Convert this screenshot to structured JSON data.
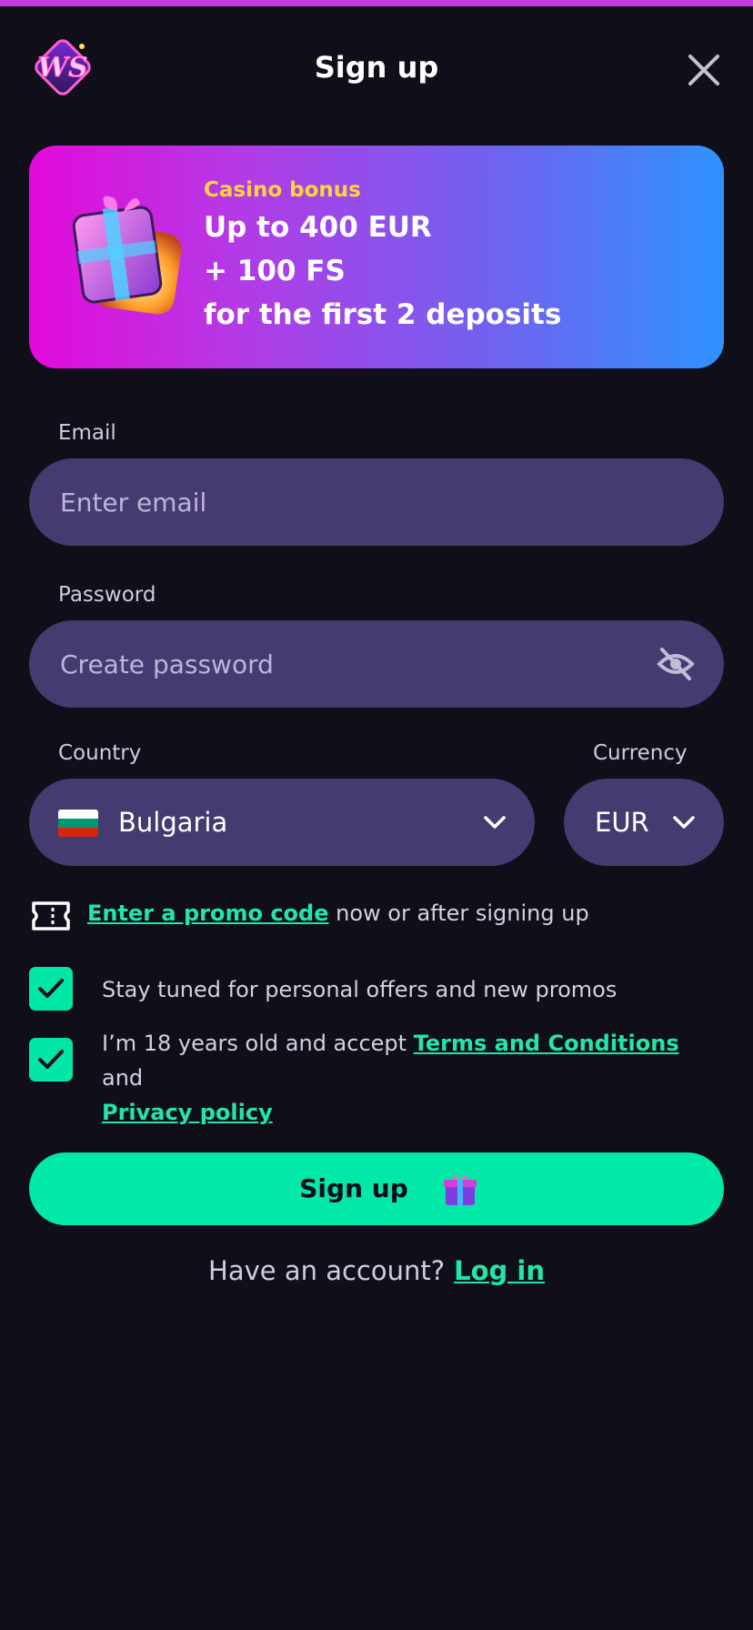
{
  "header": {
    "title": "Sign up",
    "logo_text": "WS"
  },
  "bonus": {
    "tag": "Casino bonus",
    "line1": "Up to 400 EUR",
    "line2": "+ 100 FS",
    "line3": "for the first 2 deposits"
  },
  "email": {
    "label": "Email",
    "placeholder": "Enter email",
    "value": ""
  },
  "password": {
    "label": "Password",
    "placeholder": "Create password",
    "value": ""
  },
  "country": {
    "label": "Country",
    "value": "Bulgaria",
    "flag_colors": [
      "#ffffff",
      "#00966e",
      "#d62612"
    ]
  },
  "currency": {
    "label": "Currency",
    "value": "EUR"
  },
  "promo": {
    "link": "Enter a promo code",
    "suffix": " now or after signing up"
  },
  "consents": {
    "offers": {
      "checked": true,
      "text": "Stay tuned for personal offers and new promos"
    },
    "age": {
      "checked": true,
      "prefix": "I’m 18 years old and accept ",
      "terms_link": "Terms and Conditions",
      "middle": " and",
      "privacy_link": "Privacy policy"
    }
  },
  "signup_button": {
    "label": "Sign up"
  },
  "login": {
    "prompt": "Have an account?",
    "link": "Log in"
  },
  "colors": {
    "background": "#100e19",
    "accent": "#00e9a6",
    "field": "#463b70",
    "bonus_tag": "#ffd43b"
  }
}
